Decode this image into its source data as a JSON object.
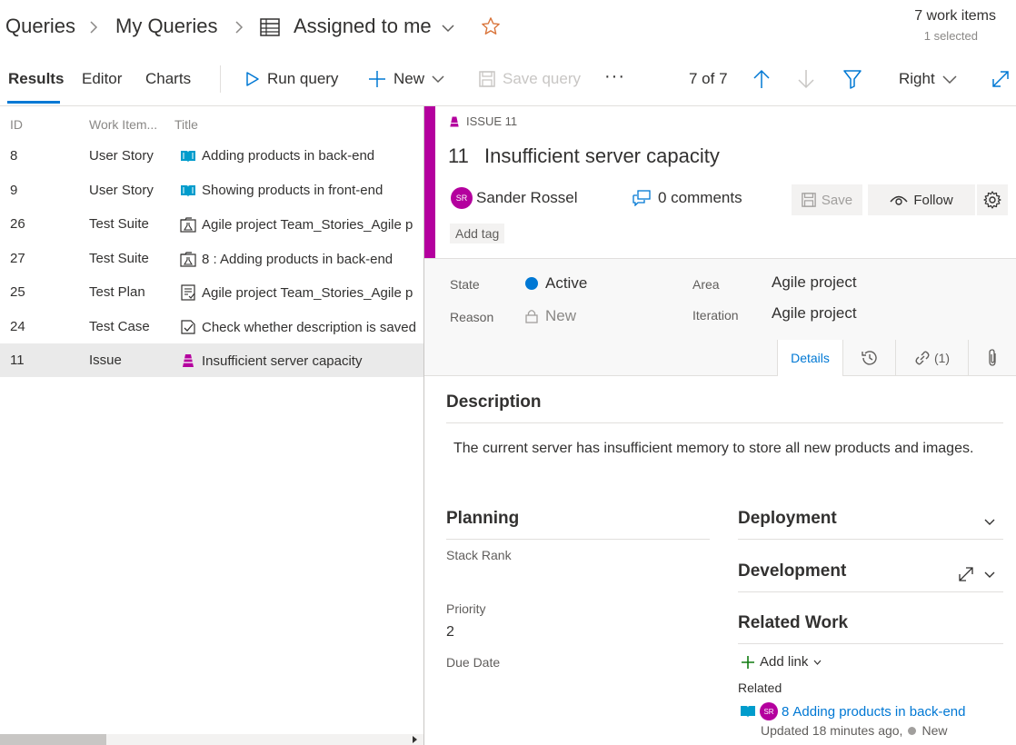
{
  "breadcrumb": {
    "item1": "Queries",
    "item2": "My Queries",
    "item3": "Assigned to me"
  },
  "counts": {
    "main": "7 work items",
    "sub": "1 selected"
  },
  "toolbar": {
    "tab_results": "Results",
    "tab_editor": "Editor",
    "tab_charts": "Charts",
    "run_query": "Run query",
    "new": "New",
    "save_query": "Save query",
    "more": "···",
    "pager": "7 of 7",
    "pane_position": "Right"
  },
  "results": {
    "columns": [
      "ID",
      "Work Item...",
      "Title"
    ],
    "rows": [
      {
        "id": "8",
        "type": "User Story",
        "title": "Adding products in back-end",
        "icon": "book-icon"
      },
      {
        "id": "9",
        "type": "User Story",
        "title": "Showing products in front-end",
        "icon": "book-icon"
      },
      {
        "id": "26",
        "type": "Test Suite",
        "title": "Agile project Team_Stories_Agile p",
        "icon": "test-suite-icon"
      },
      {
        "id": "27",
        "type": "Test Suite",
        "title": "8 : Adding products in back-end",
        "icon": "test-suite-icon"
      },
      {
        "id": "25",
        "type": "Test Plan",
        "title": "Agile project Team_Stories_Agile p",
        "icon": "test-plan-icon"
      },
      {
        "id": "24",
        "type": "Test Case",
        "title": "Check whether description is saved",
        "icon": "test-case-icon"
      },
      {
        "id": "11",
        "type": "Issue",
        "title": "Insufficient server capacity",
        "icon": "issue-icon"
      }
    ]
  },
  "detail": {
    "type_label": "ISSUE 11",
    "id": "11",
    "title": "Insufficient server capacity",
    "assignee": "Sander Rossel",
    "assignee_initials": "SR",
    "comments": "0 comments",
    "save": "Save",
    "follow": "Follow",
    "add_tag": "Add tag",
    "fields": {
      "state_label": "State",
      "state_value": "Active",
      "reason_label": "Reason",
      "reason_value": "New",
      "area_label": "Area",
      "area_value": "Agile project",
      "iteration_label": "Iteration",
      "iteration_value": "Agile project"
    },
    "tabs": {
      "details": "Details",
      "links_count": "(1)"
    },
    "description_title": "Description",
    "description_text": "The current server has insufficient memory to store all new products and images.",
    "planning": {
      "title": "Planning",
      "stack_rank_label": "Stack Rank",
      "priority_label": "Priority",
      "priority_value": "2",
      "due_date_label": "Due Date"
    },
    "deployment_title": "Deployment",
    "development_title": "Development",
    "related_work": {
      "title": "Related Work",
      "add_link": "Add link",
      "related_label": "Related",
      "link_id": "8",
      "link_title": "Adding products in back-end",
      "link_meta": "Updated 18 minutes ago,",
      "link_state": "New"
    }
  },
  "colors": {
    "accent": "#0078d4",
    "issue": "#b4009e",
    "active_state": "#0078d4",
    "star": "#d9743a"
  }
}
